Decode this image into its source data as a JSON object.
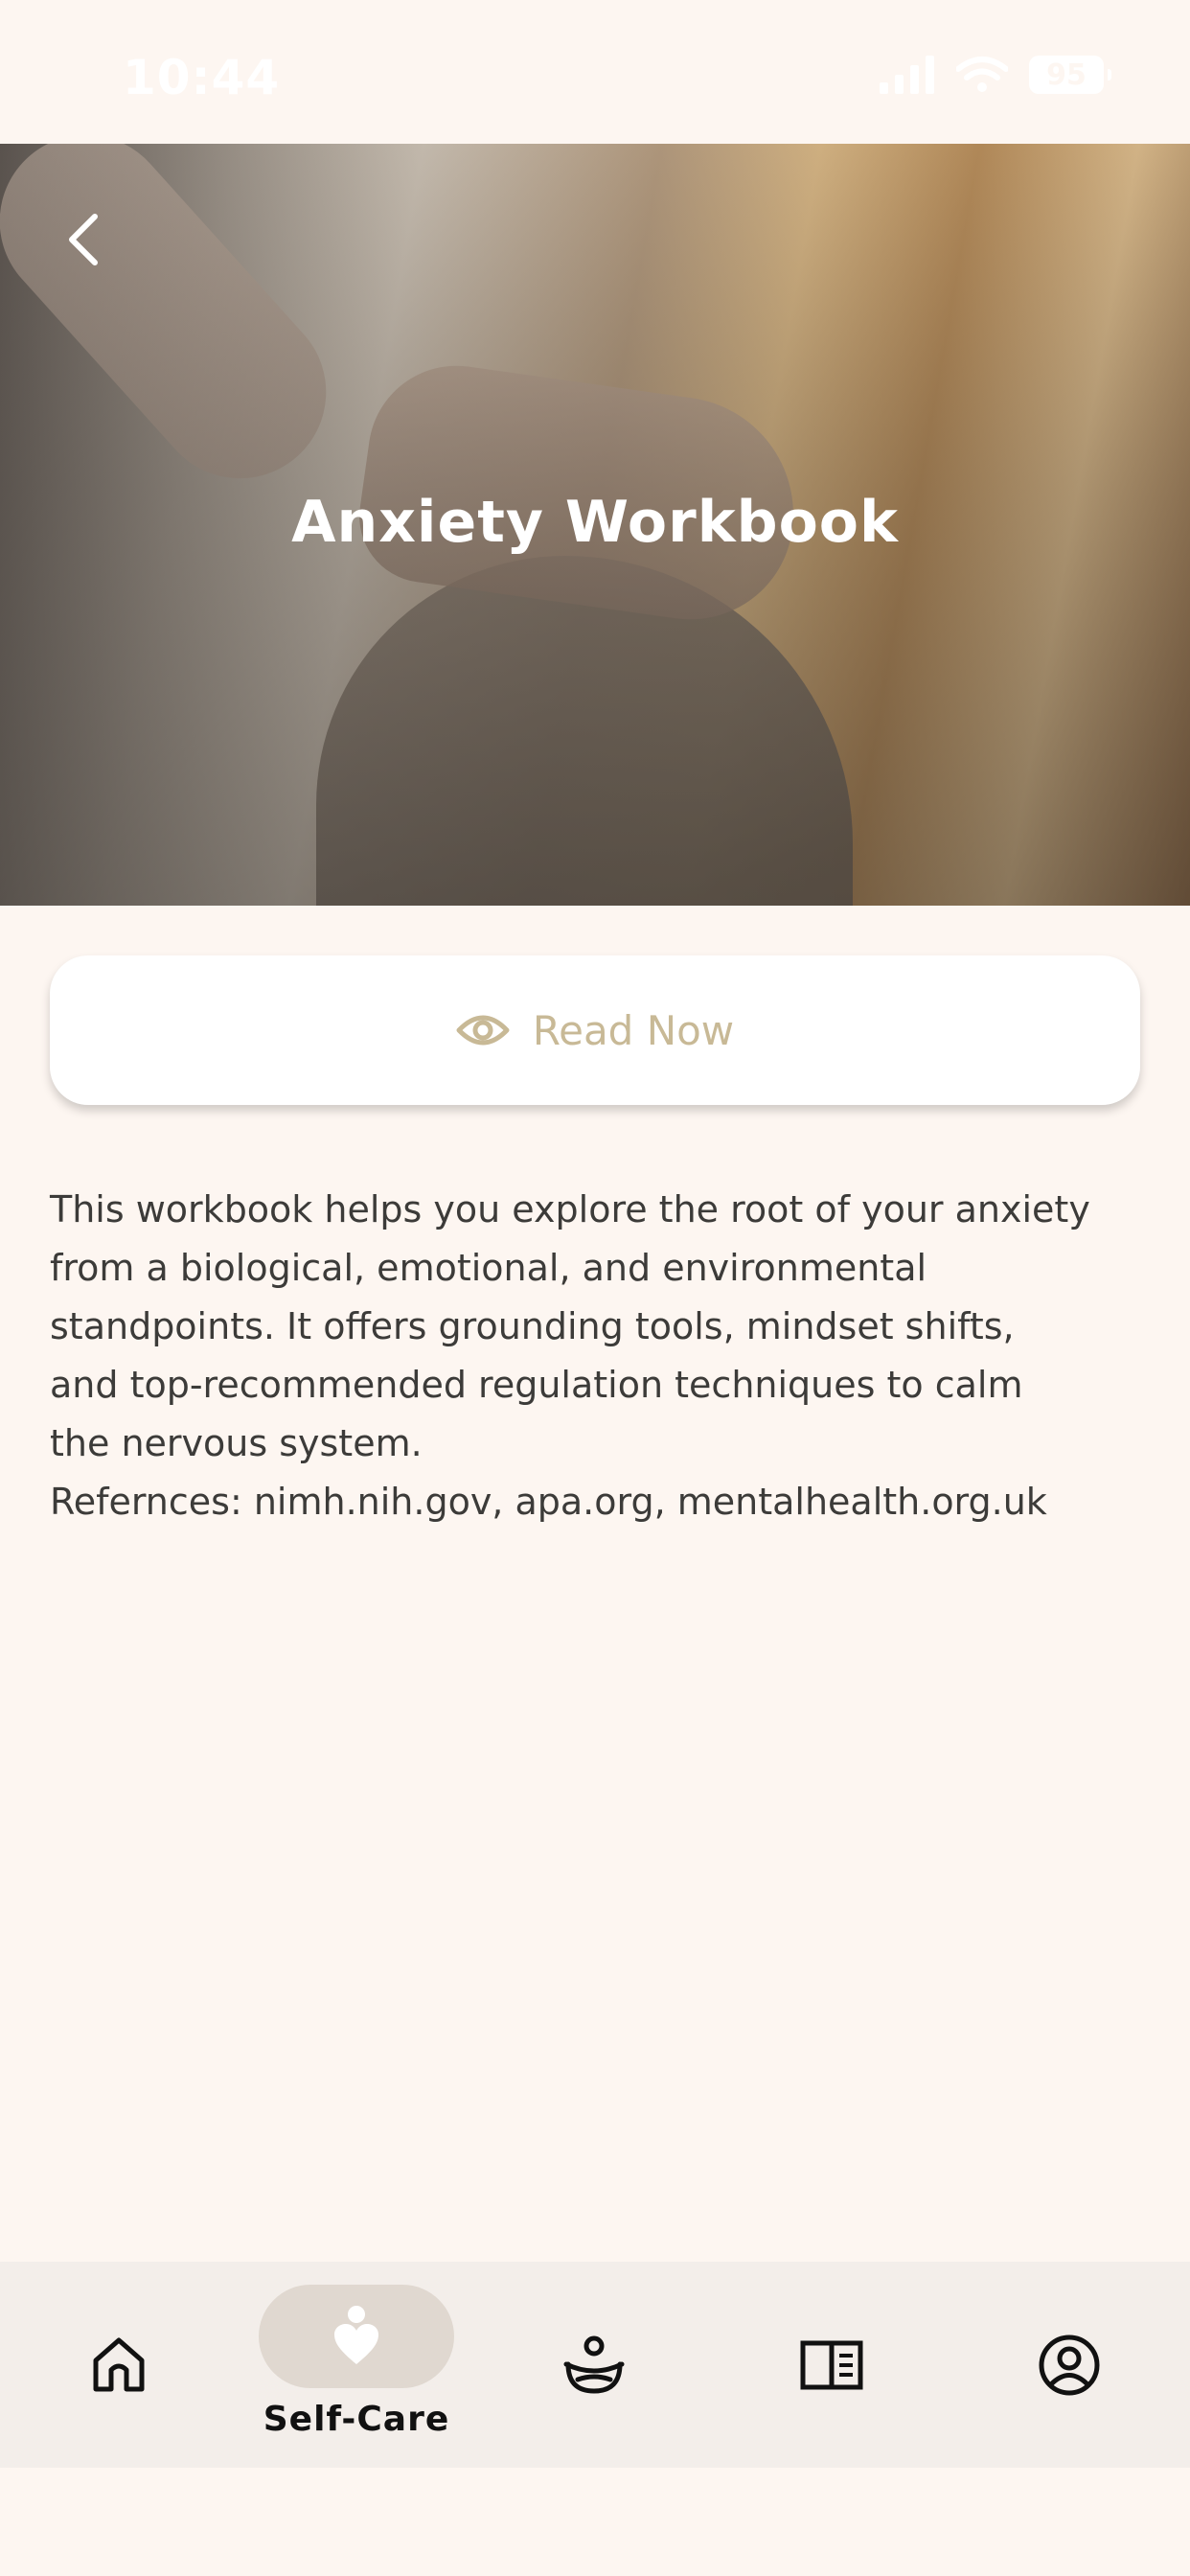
{
  "status_bar": {
    "time": "10:44",
    "battery": "95"
  },
  "header": {
    "title": "Anxiety Workbook",
    "back_icon": "chevron-left-icon"
  },
  "read_button": {
    "label": "Read Now",
    "icon": "eye-icon"
  },
  "description": "This workbook helps you explore the root of your anxiety\nfrom a biological, emotional, and environmental\nstandpoints. It offers grounding tools, mindset shifts,\nand top-recommended regulation techniques to calm\nthe nervous system.\nRefernces: nimh.nih.gov, apa.org, mentalhealth.org.uk",
  "bottom_nav": {
    "items": [
      {
        "icon": "home-icon",
        "label": ""
      },
      {
        "icon": "self-care-icon",
        "label": "Self-Care",
        "active": true
      },
      {
        "icon": "meditation-icon",
        "label": ""
      },
      {
        "icon": "journal-icon",
        "label": ""
      },
      {
        "icon": "profile-icon",
        "label": ""
      }
    ]
  },
  "colors": {
    "background": "#fdf6f1",
    "accent": "#c8b996",
    "nav_background": "#f3eeea",
    "active_pill": "#e0d8d0"
  }
}
